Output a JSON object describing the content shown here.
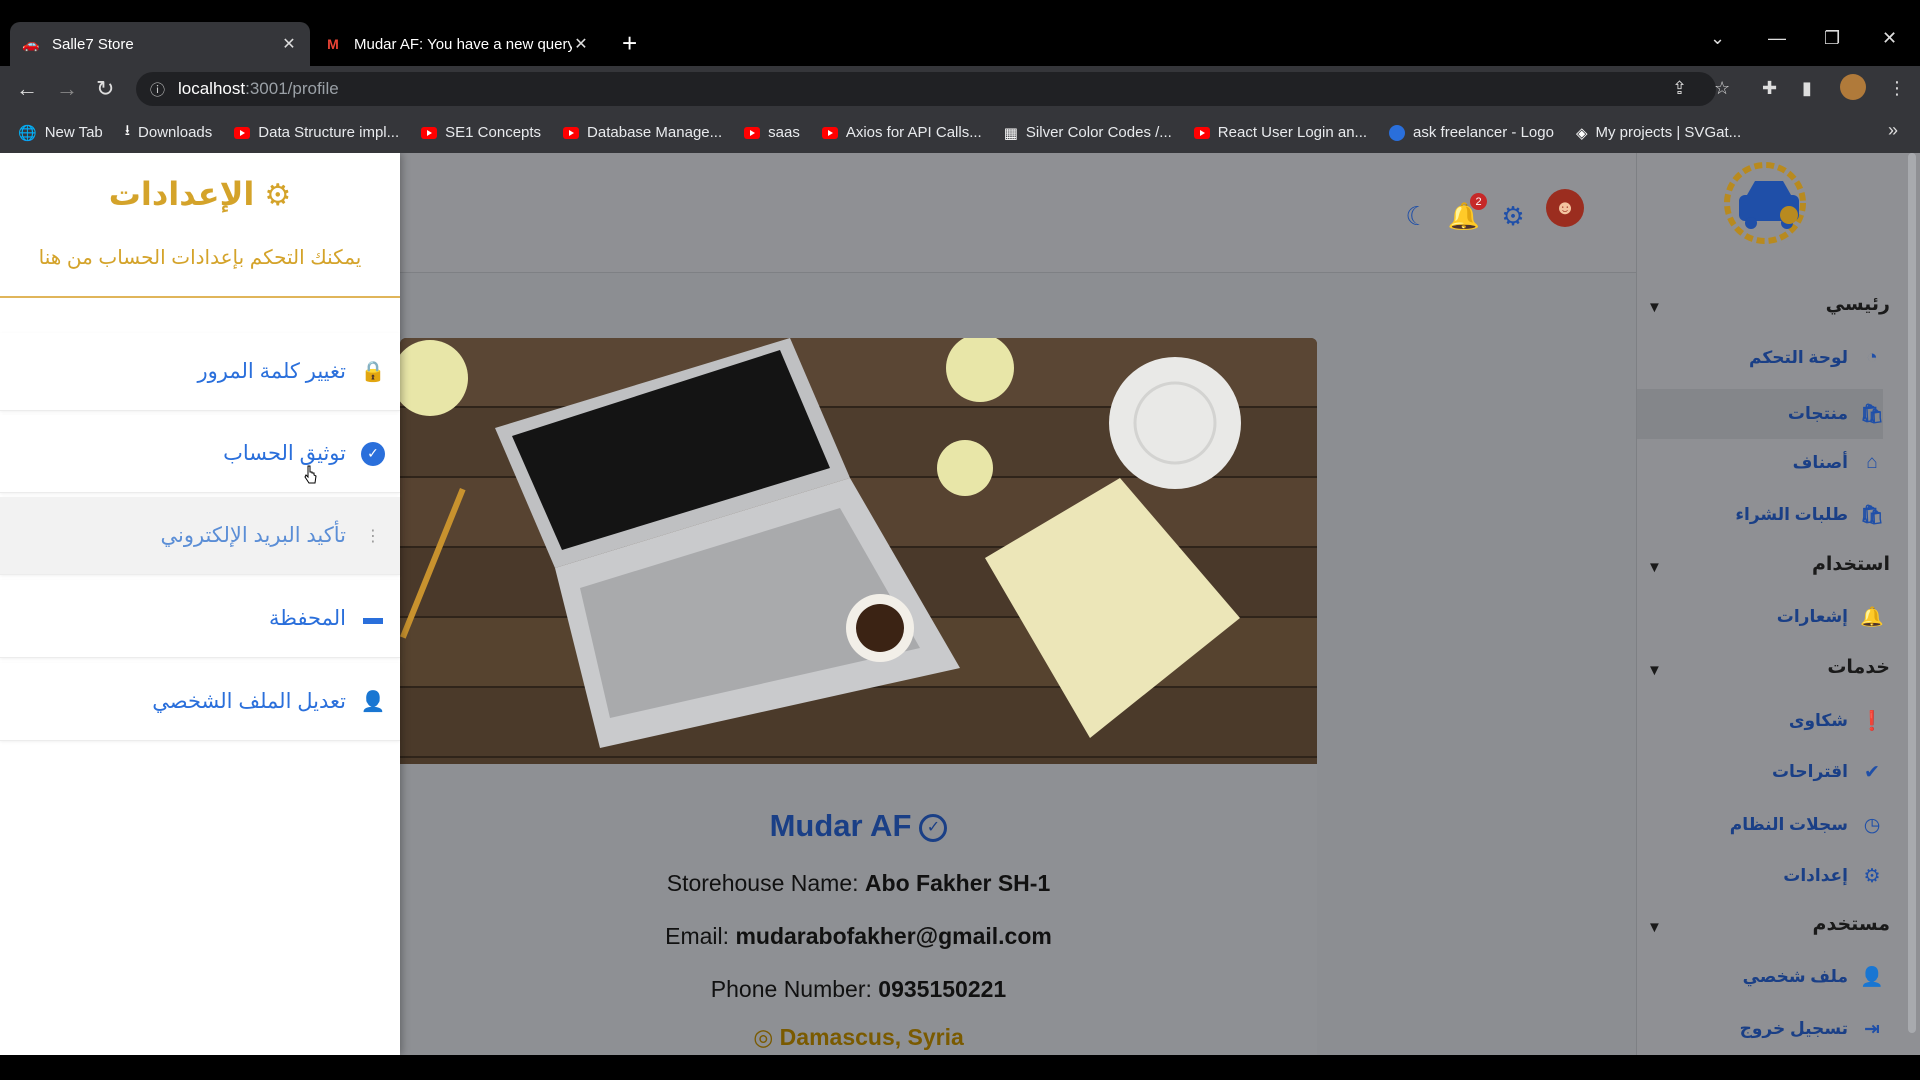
{
  "browser": {
    "tabs": [
      {
        "title": "Salle7 Store",
        "active": true
      },
      {
        "title": "Mudar AF: You have a new query",
        "active": false
      }
    ],
    "url_host": "localhost",
    "url_rest": ":3001/profile",
    "bookmarks": [
      {
        "label": "New Tab",
        "icon": "globe-icon"
      },
      {
        "label": "Downloads",
        "icon": "download-icon"
      },
      {
        "label": "Data Structure impl...",
        "icon": "youtube-icon"
      },
      {
        "label": "SE1 Concepts",
        "icon": "youtube-icon"
      },
      {
        "label": "Database Manage...",
        "icon": "youtube-icon"
      },
      {
        "label": "saas",
        "icon": "youtube-icon"
      },
      {
        "label": "Axios for API Calls...",
        "icon": "youtube-icon"
      },
      {
        "label": "Silver Color Codes /...",
        "icon": "grid-icon"
      },
      {
        "label": "React User Login an...",
        "icon": "youtube-icon"
      },
      {
        "label": "ask freelancer - Logo",
        "icon": "circle-logo-icon"
      },
      {
        "label": "My projects | SVGat...",
        "icon": "svg-icon"
      }
    ]
  },
  "header": {
    "notification_count": "2"
  },
  "sidebar": {
    "sections": [
      {
        "title": "رئيسي",
        "items": [
          "لوحة التحكم",
          "منتجات",
          "أصناف",
          "طلبات الشراء"
        ]
      },
      {
        "title": "استخدام",
        "items": [
          "إشعارات"
        ]
      },
      {
        "title": "خدمات",
        "items": [
          "شكاوى",
          "اقتراحات",
          "سجلات النظام",
          "إعدادات"
        ]
      },
      {
        "title": "مستخدم",
        "items": [
          "ملف شخصي",
          "تسجيل خروج"
        ]
      }
    ]
  },
  "profile": {
    "name": "Mudar AF",
    "storehouse_label": "Storehouse Name:",
    "storehouse_value": "Abo Fakher SH-1",
    "email_label": "Email:",
    "email_value": "mudarabofakher@gmail.com",
    "phone_label": "Phone Number:",
    "phone_value": "0935150221",
    "location": "Damascus, Syria"
  },
  "settings_drawer": {
    "title": "الإعدادات",
    "subtitle": "يمكنك التحكم بإعدادات الحساب من هنا",
    "items": [
      {
        "label": "تغيير كلمة المرور",
        "icon": "lock-icon"
      },
      {
        "label": "توثيق الحساب",
        "icon": "verified-icon"
      },
      {
        "label": "تأكيد البريد الإلكتروني",
        "icon": "dots-icon"
      },
      {
        "label": "المحفظة",
        "icon": "wallet-icon"
      },
      {
        "label": "تعديل الملف الشخصي",
        "icon": "user-icon"
      }
    ]
  }
}
